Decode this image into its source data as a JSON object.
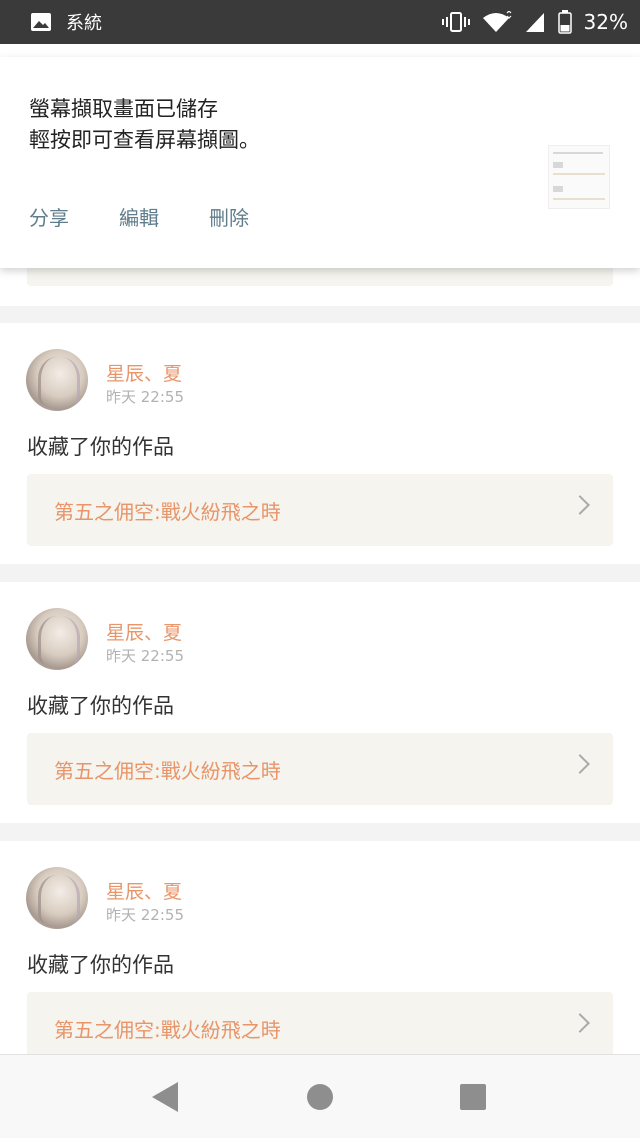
{
  "status_bar": {
    "app_label": "系統",
    "battery": "32%",
    "icons": [
      "image-icon",
      "vibrate-icon",
      "wifi-icon",
      "signal-icon",
      "battery-icon"
    ]
  },
  "notification": {
    "line1": "螢幕擷取畫面已儲存",
    "line2": "輕按即可查看屏幕擷圖。",
    "actions": [
      "分享",
      "編輯",
      "刪除"
    ]
  },
  "feed": {
    "items": [
      {
        "user": "星辰、夏",
        "time": "昨天 22:55",
        "action": "收藏了你的作品",
        "work_title": "第五之佣空:戰火紛飛之時"
      },
      {
        "user": "星辰、夏",
        "time": "昨天 22:55",
        "action": "收藏了你的作品",
        "work_title": "第五之佣空:戰火紛飛之時"
      },
      {
        "user": "星辰、夏",
        "time": "昨天 22:55",
        "action": "收藏了你的作品",
        "work_title": "第五之佣空:戰火紛飛之時"
      }
    ]
  },
  "colors": {
    "accent": "#e8956a",
    "notification_action": "#607d8b",
    "card_bg": "#f5f4ee",
    "status_bar": "#3a3a3a"
  },
  "nav": {
    "icons": [
      "back-icon",
      "home-icon",
      "recents-icon"
    ]
  }
}
